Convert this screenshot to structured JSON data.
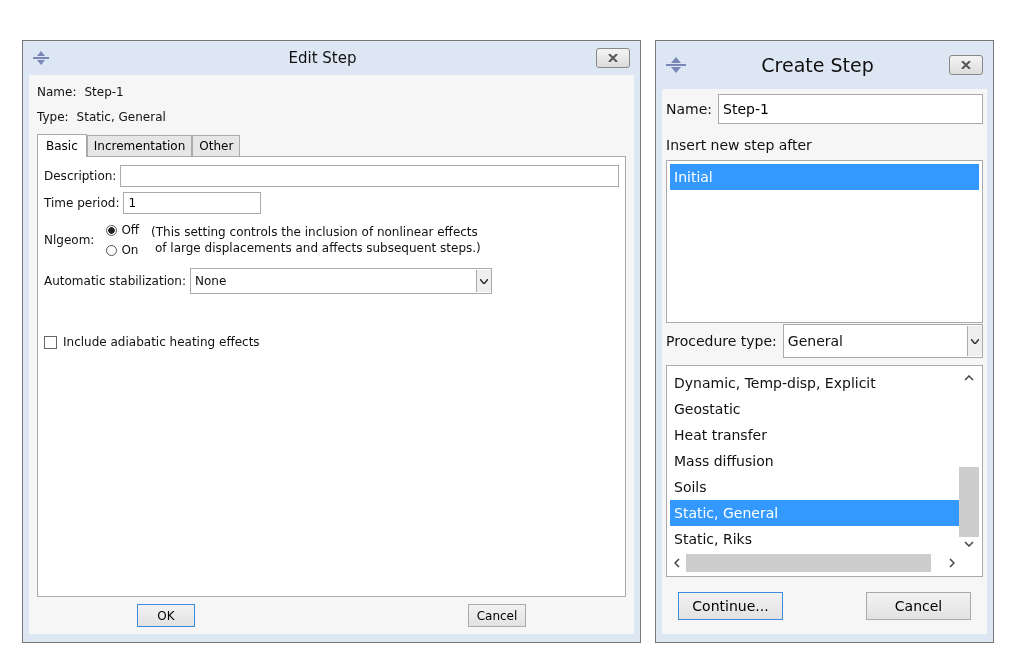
{
  "edit_step": {
    "title": "Edit Step",
    "name_label": "Name:",
    "name": "Step-1",
    "type_label": "Type:",
    "type": "Static, General",
    "tabs": [
      {
        "label": "Basic",
        "selected": true
      },
      {
        "label": "Incrementation",
        "selected": false
      },
      {
        "label": "Other",
        "selected": false
      }
    ],
    "description_label": "Description:",
    "time_period_label": "Time period:",
    "time_period": "1",
    "nlgeom_label": "Nlgeom:",
    "nlgeom_options": [
      {
        "label": "Off",
        "selected": true
      },
      {
        "label": "On",
        "selected": false
      }
    ],
    "nlgeom_note": "(This setting controls the inclusion of nonlinear effects\n of large displacements and affects subsequent steps.)",
    "stabilization_label": "Automatic stabilization:",
    "stabilization": "None",
    "adiabatic": {
      "label": "Include adiabatic heating effects",
      "checked": false
    },
    "buttons": [
      {
        "label": "OK",
        "focused": true
      },
      {
        "label": "Cancel",
        "focused": false
      }
    ]
  },
  "create_step": {
    "title": "Create Step",
    "name_label": "Name:",
    "name": "Step-1",
    "insert_label": "Insert new step after",
    "steps": [
      {
        "label": "Initial",
        "selected": true
      }
    ],
    "procedure_label": "Procedure type:",
    "procedure": "General",
    "procedures": [
      {
        "label": "Dynamic, Temp-disp, Explicit",
        "selected": false
      },
      {
        "label": "Geostatic",
        "selected": false
      },
      {
        "label": "Heat transfer",
        "selected": false
      },
      {
        "label": "Mass diffusion",
        "selected": false
      },
      {
        "label": "Soils",
        "selected": false
      },
      {
        "label": "Static, General",
        "selected": true
      },
      {
        "label": "Static, Riks",
        "selected": false
      }
    ],
    "buttons": [
      {
        "label": "Continue...",
        "focused": true
      },
      {
        "label": "Cancel",
        "focused": false
      }
    ]
  }
}
